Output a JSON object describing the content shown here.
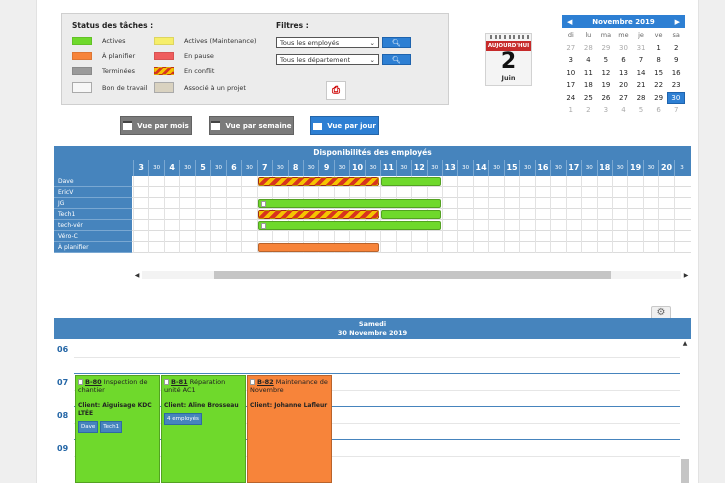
{
  "legend": {
    "title": "Status des tâches :",
    "items": [
      {
        "label": "Actives",
        "color": "#6fd92c",
        "kind": "solid"
      },
      {
        "label": "Actives (Maintenance)",
        "color": "#f6ee6a",
        "kind": "solid"
      },
      {
        "label": "À planifier",
        "color": "#f7843a",
        "kind": "solid"
      },
      {
        "label": "En pause",
        "color": "#ef5d5d",
        "kind": "solid"
      },
      {
        "label": "Terminées",
        "color": "#9a9a9a",
        "kind": "solid"
      },
      {
        "label": "En conflit",
        "color": "#d8341e",
        "kind": "striped"
      },
      {
        "label": "Bon de travail",
        "color": "#f7f7f7",
        "kind": "icon"
      },
      {
        "label": "Associé à un projet",
        "color": "#d9d2c0",
        "kind": "icon"
      }
    ]
  },
  "filters": {
    "title": "Filtres :",
    "employees": "Tous les employés",
    "departments": "Tous les département"
  },
  "today": {
    "label": "AUJOURD'HUI",
    "day": "2",
    "month": "Juin"
  },
  "calendar": {
    "title": "Novembre 2019",
    "daynames": [
      "di",
      "lu",
      "ma",
      "me",
      "je",
      "ve",
      "sa"
    ],
    "weeks": [
      [
        {
          "d": "27",
          "dim": true
        },
        {
          "d": "28",
          "dim": true
        },
        {
          "d": "29",
          "dim": true
        },
        {
          "d": "30",
          "dim": true
        },
        {
          "d": "31",
          "dim": true
        },
        {
          "d": "1"
        },
        {
          "d": "2"
        }
      ],
      [
        {
          "d": "3"
        },
        {
          "d": "4"
        },
        {
          "d": "5"
        },
        {
          "d": "6"
        },
        {
          "d": "7"
        },
        {
          "d": "8"
        },
        {
          "d": "9"
        }
      ],
      [
        {
          "d": "10"
        },
        {
          "d": "11"
        },
        {
          "d": "12"
        },
        {
          "d": "13"
        },
        {
          "d": "14"
        },
        {
          "d": "15"
        },
        {
          "d": "16"
        }
      ],
      [
        {
          "d": "17"
        },
        {
          "d": "18"
        },
        {
          "d": "19"
        },
        {
          "d": "20"
        },
        {
          "d": "21"
        },
        {
          "d": "22"
        },
        {
          "d": "23"
        }
      ],
      [
        {
          "d": "24"
        },
        {
          "d": "25"
        },
        {
          "d": "26"
        },
        {
          "d": "27"
        },
        {
          "d": "28"
        },
        {
          "d": "29"
        },
        {
          "d": "30",
          "selected": true
        }
      ],
      [
        {
          "d": "1",
          "dim": true
        },
        {
          "d": "2",
          "dim": true
        },
        {
          "d": "3",
          "dim": true
        },
        {
          "d": "4",
          "dim": true
        },
        {
          "d": "5",
          "dim": true
        },
        {
          "d": "6",
          "dim": true
        },
        {
          "d": "7",
          "dim": true
        }
      ]
    ]
  },
  "views": {
    "month": "Vue par mois",
    "week": "Vue par semaine",
    "day": "Vue par jour"
  },
  "availability": {
    "title": "Disponibilités des employés",
    "hour_labels": [
      "3",
      "30",
      "4",
      "30",
      "5",
      "30",
      "6",
      "30",
      "7",
      "30",
      "8",
      "30",
      "9",
      "30",
      "10",
      "30",
      "11",
      "30",
      "12",
      "30",
      "13",
      "30",
      "14",
      "30",
      "15",
      "30",
      "16",
      "30",
      "17",
      "30",
      "18",
      "30",
      "19",
      "30",
      "20",
      "3"
    ],
    "employees": [
      {
        "name": "Dave",
        "bars": [
          {
            "start": "7:00",
            "end": "11:00",
            "status": "conflict"
          },
          {
            "start": "11:00",
            "end": "13:00",
            "status": "green"
          }
        ]
      },
      {
        "name": "EricV",
        "bars": []
      },
      {
        "name": "JG",
        "bars": [
          {
            "start": "7:00",
            "end": "13:00",
            "status": "green",
            "doc": true
          }
        ]
      },
      {
        "name": "Tech1",
        "bars": [
          {
            "start": "7:00",
            "end": "11:00",
            "status": "conflict"
          },
          {
            "start": "11:00",
            "end": "13:00",
            "status": "green"
          }
        ]
      },
      {
        "name": "tech-vér",
        "bars": [
          {
            "start": "7:00",
            "end": "13:00",
            "status": "green",
            "doc": true
          }
        ]
      },
      {
        "name": "Véro-C",
        "bars": []
      },
      {
        "name": "À planifier",
        "bars": [
          {
            "start": "7:00",
            "end": "11:00",
            "status": "orange"
          }
        ]
      }
    ]
  },
  "dayview": {
    "weekday": "Samedi",
    "date": "30 Novembre 2019",
    "hours": [
      "06",
      "07",
      "08",
      "09"
    ],
    "tasks": [
      {
        "id": "B-80",
        "title": "Inspection de chantier",
        "client": "Client: Aiguisage KDC LTÉE",
        "tags": [
          "Dave",
          "Tech1"
        ],
        "color": "green"
      },
      {
        "id": "B-81",
        "title": "Réparation unité AC1",
        "client": "Client: Aline Brosseau",
        "tags": [
          "4 employés"
        ],
        "color": "green"
      },
      {
        "id": "B-82",
        "title": "Maintenance de Novembre",
        "client": "Client: Johanne Lafleur",
        "tags": [],
        "color": "orange"
      }
    ]
  }
}
